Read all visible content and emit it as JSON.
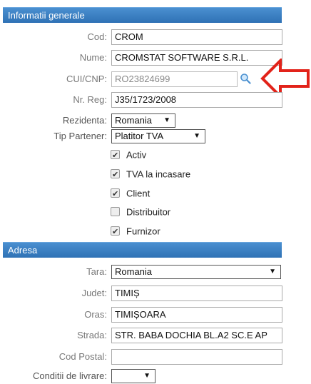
{
  "general": {
    "header": "Informatii generale",
    "cod_label": "Cod:",
    "cod_value": "CROM",
    "nume_label": "Nume:",
    "nume_value": "CROMSTAT SOFTWARE S.R.L.",
    "cui_label": "CUI/CNP:",
    "cui_value": "RO23824699",
    "nrreg_label": "Nr. Reg:",
    "nrreg_value": "J35/1723/2008",
    "rezidenta_label": "Rezidenta:",
    "rezidenta_value": "Romania",
    "tip_label": "Tip Partener:",
    "tip_value": "Platitor TVA",
    "checkboxes": [
      {
        "label": "Activ",
        "checked": true
      },
      {
        "label": "TVA la incasare",
        "checked": true
      },
      {
        "label": "Client",
        "checked": true
      },
      {
        "label": "Distribuitor",
        "checked": false
      },
      {
        "label": "Furnizor",
        "checked": true
      }
    ]
  },
  "adresa": {
    "header": "Adresa",
    "tara_label": "Tara:",
    "tara_value": "Romania",
    "judet_label": "Judet:",
    "judet_value": "TIMIȘ",
    "oras_label": "Oras:",
    "oras_value": "TIMIȘOARA",
    "strada_label": "Strada:",
    "strada_value": "STR. BABA DOCHIA BL.A2 SC.E AP",
    "codpostal_label": "Cod Postal:",
    "codpostal_value": "",
    "conditii_label": "Conditii de livrare:",
    "conditii_value": ""
  },
  "colors": {
    "header": "#3a80c4",
    "arrow": "#e2231a"
  },
  "icons": {
    "search": "search-icon",
    "annotation": "red-arrow-icon"
  }
}
